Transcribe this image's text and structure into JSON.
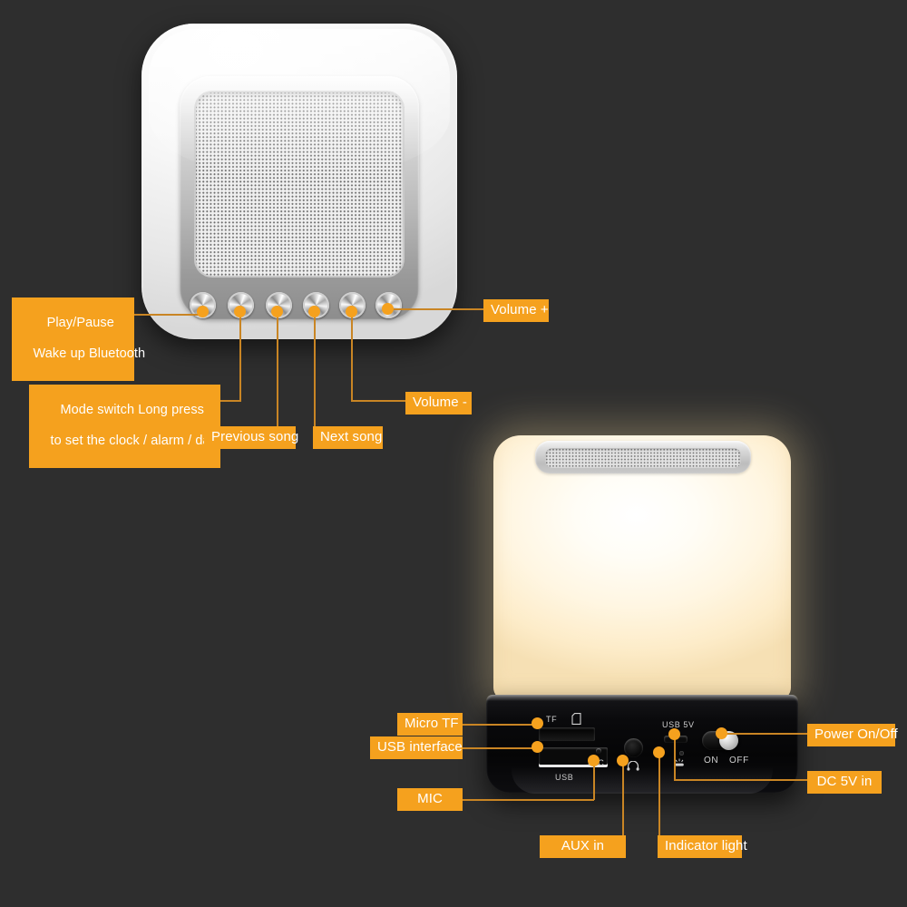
{
  "page": {
    "background_color": "#2e2e2e",
    "accent_color": "#f5a11e",
    "leader_line_color": "#c98524"
  },
  "products": {
    "top_speaker": {
      "name": "bluetooth-speaker-top-view",
      "button_count": 6
    },
    "lamp_speaker": {
      "name": "touch-lamp-bluetooth-speaker",
      "port_panel_labels": {
        "tf": "TF",
        "usb": "USB",
        "mic": "MIC",
        "usb_5v": "USB 5V",
        "switch_on": "ON",
        "switch_off": "OFF"
      }
    }
  },
  "callouts": {
    "play_pause": {
      "line1": "Play/Pause",
      "line2": "Wake up Bluetooth"
    },
    "mode_switch": {
      "line1": "Mode switch Long press",
      "line2": "to set the clock / alarm / date"
    },
    "previous_song": "Previous song",
    "next_song": "Next song",
    "volume_up": "Volume +",
    "volume_down": "Volume -",
    "micro_tf": "Micro TF",
    "usb_interface": "USB interface",
    "mic": "MIC",
    "aux_in": "AUX in",
    "indicator_light": "Indicator light",
    "power_on_off": "Power On/Off",
    "dc_5v_in": "DC 5V in"
  }
}
